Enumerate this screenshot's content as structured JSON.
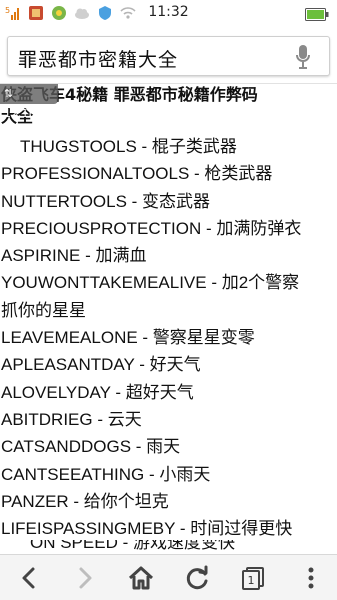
{
  "status_bar": {
    "time": "11:32",
    "signal_label": "5"
  },
  "address_bar": {
    "query": "罪恶都市密籍大全"
  },
  "content": {
    "speed_badge": "12.1B/s",
    "heading_line1": "侠盗飞车4秘籍 罪恶都市秘籍作弊码",
    "heading_line2": "大全",
    "cheats": [
      {
        "text": "THUGSTOOLS - 棍子类武器",
        "indent": true
      },
      {
        "text": "PROFESSIONALTOOLS - 枪类武器",
        "indent": false
      },
      {
        "text": "NUTTERTOOLS - 变态武器",
        "indent": false
      },
      {
        "text": "PRECIOUSPROTECTION - 加满防弹衣",
        "indent": false
      },
      {
        "text": "ASPIRINE - 加满血",
        "indent": false
      },
      {
        "text": "YOUWONTTAKEMEALIVE - 加2个警察",
        "indent": false
      },
      {
        "text": "抓你的星星",
        "indent": false
      },
      {
        "text": "LEAVEMEALONE - 警察星星变零",
        "indent": false
      },
      {
        "text": "APLEASANTDAY - 好天气",
        "indent": false
      },
      {
        "text": "ALOVELYDAY - 超好天气",
        "indent": false
      },
      {
        "text": "ABITDRIEG - 云天",
        "indent": false
      },
      {
        "text": "CATSANDDOGS - 雨天",
        "indent": false
      },
      {
        "text": "CANTSEEATHING - 小雨天",
        "indent": false
      },
      {
        "text": "PANZER - 给你个坦克",
        "indent": false
      },
      {
        "text": "LIFEISPASSINGMEBY - 时间过得更快",
        "indent": false
      }
    ],
    "cutoff_line": "ON SPEED - 游戏速度变快"
  },
  "toolbar": {
    "tab_count": "1"
  },
  "colors": {
    "accent": "#3a8ee6",
    "toolbar_bg": "#f4f4f4"
  }
}
